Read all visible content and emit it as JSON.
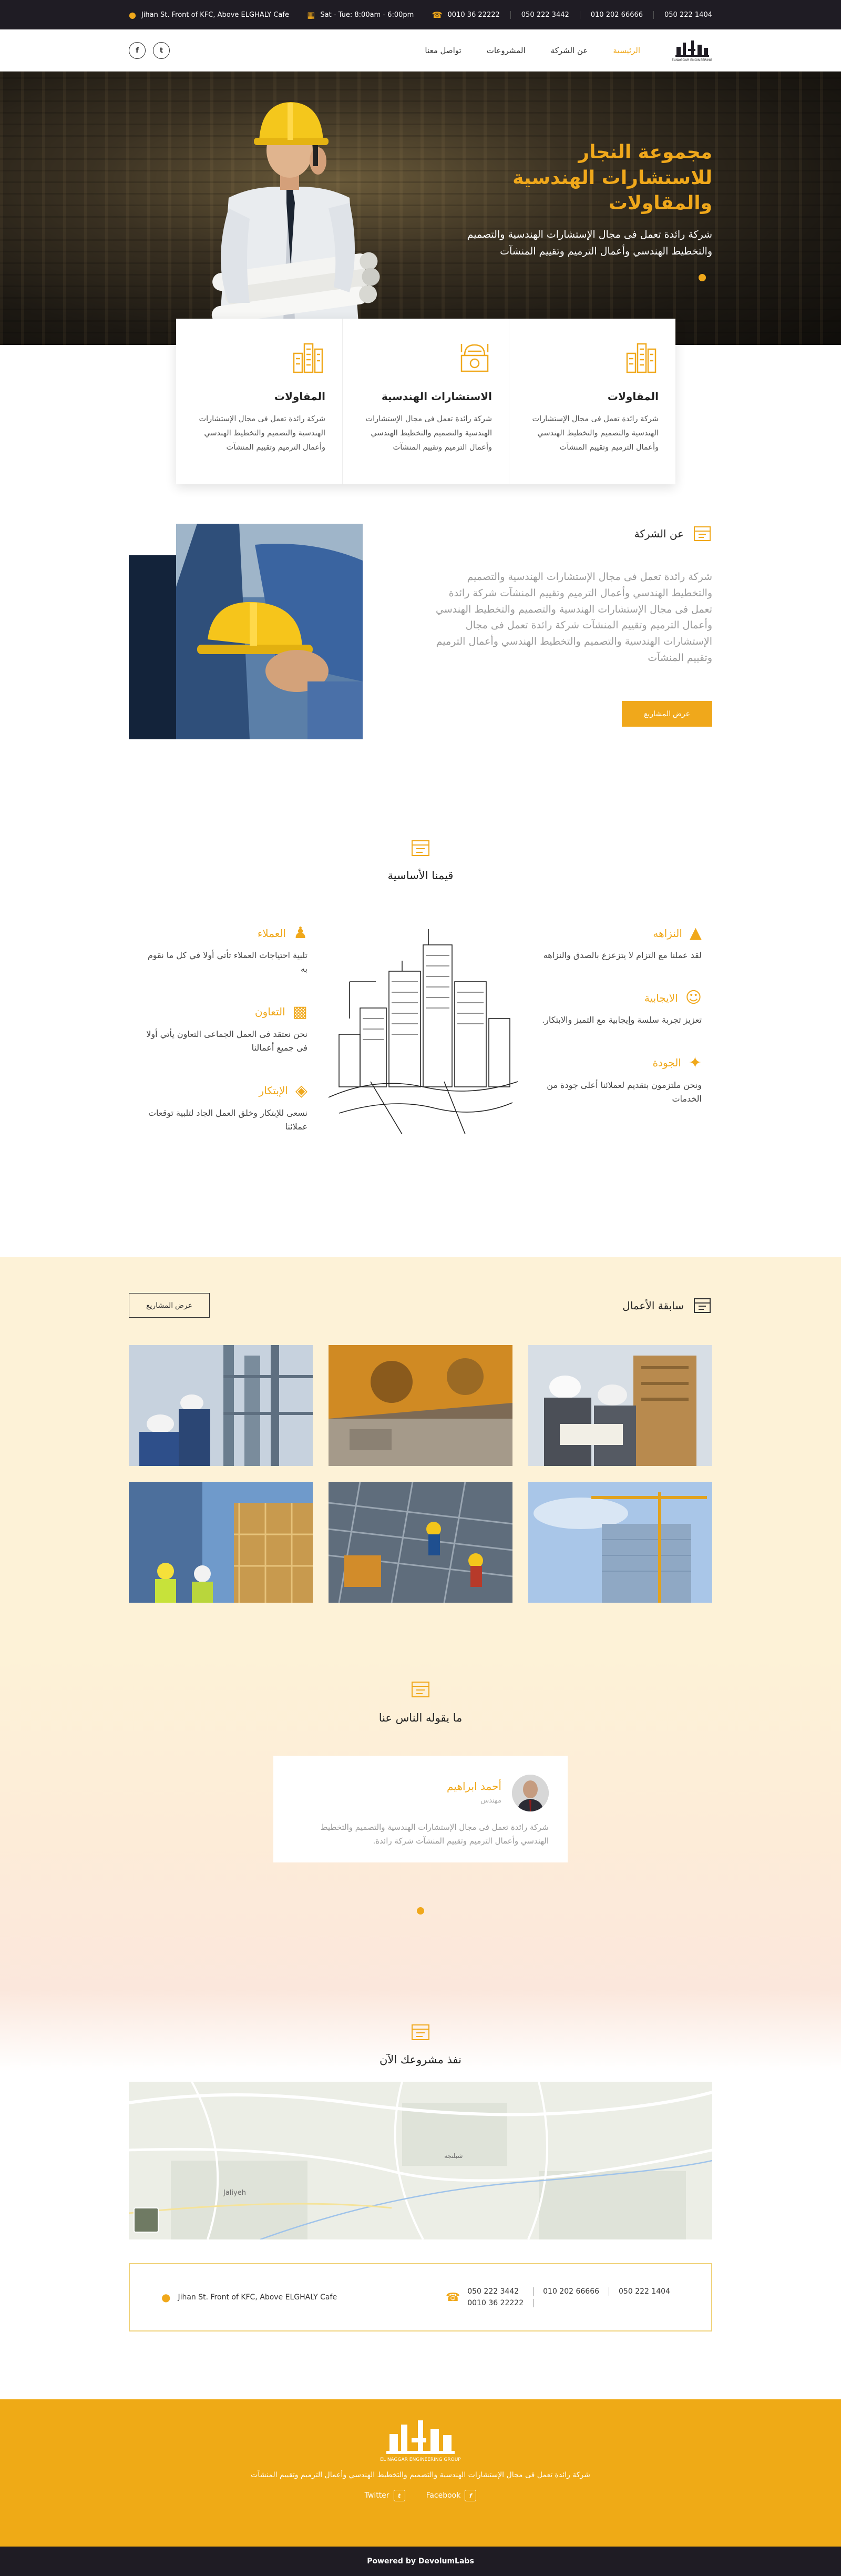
{
  "topbar": {
    "address": "Jihan St. Front of KFC, Above ELGHALY Cafe",
    "hours": "Sat - Tue: 8:00am - 6:00pm",
    "phones": [
      "0010 36 22222",
      "050 222 3442",
      "010 202 66666",
      "050 222 1404"
    ]
  },
  "nav": {
    "items": [
      "الرئيسية",
      "عن الشركة",
      "المشروعات",
      "تواصل معنا"
    ],
    "logo_caption": "ELNAGGAR ENGINEERING",
    "social": {
      "facebook": "f",
      "twitter": "t"
    }
  },
  "hero": {
    "title": "مجموعة النجار للاستشارات الهندسية والمقاولات",
    "text": "شركة رائدة تعمل فى مجال الإستشارات الهندسية والتصميم والتخطيط الهندسي وأعمال الترميم وتقييم المنشآت"
  },
  "features": [
    {
      "title": "المقاولات",
      "text": "شركة رائدة تعمل فى مجال الإستشارات الهندسية والتصميم والتخطيط الهندسي وأعمال الترميم وتقييم المنشآت",
      "icon": "buildings-icon"
    },
    {
      "title": "الاستشارات الهندسية",
      "text": "شركة رائدة تعمل فى مجال الإستشارات الهندسية والتصميم والتخطيط الهندسي وأعمال الترميم وتقييم المنشآت",
      "icon": "engineering-icon"
    },
    {
      "title": "المقاولات",
      "text": "شركة رائدة تعمل فى مجال الإستشارات الهندسية والتصميم والتخطيط الهندسي وأعمال الترميم وتقييم المنشآت",
      "icon": "buildings-icon"
    }
  ],
  "about": {
    "heading": "عن الشركة",
    "text": "شركة رائدة تعمل فى مجال الإستشارات الهندسية والتصميم والتخطيط الهندسي وأعمال الترميم وتقييم المنشآت شركة رائدة تعمل فى مجال الإستشارات الهندسية والتصميم والتخطيط الهندسي وأعمال الترميم وتقييم المنشآت شركة رائدة تعمل فى مجال الإستشارات الهندسية والتصميم والتخطيط الهندسي وأعمال الترميم وتقييم المنشآت",
    "button": "عرض المشاريع"
  },
  "values": {
    "heading": "قيمنا الأساسية",
    "right": [
      {
        "title": "النزاهه",
        "text": "لقد عملنا مع التزام لا يتزعزع بالصدق والنزاهه",
        "icon": "thumbs-up-icon"
      },
      {
        "title": "الايجابية",
        "text": "تعزيز تجربة سلسة وإيجابية مع التميز والابتكار.",
        "icon": "smile-icon"
      },
      {
        "title": "الجودة",
        "text": "ونحن ملتزمون بتقديم لعملائنا أعلى جودة من الخدمات",
        "icon": "quality-hand-icon"
      }
    ],
    "left": [
      {
        "title": "العملاء",
        "text": "تلبية احتياجات العملاء تأتي أولا في كل ما نقوم به",
        "icon": "people-icon"
      },
      {
        "title": "التعاون",
        "text": "نحن نعتقد فى العمل الجماعى التعاون يأتي أولا فى جميع أعمالنا",
        "icon": "handshake-icon"
      },
      {
        "title": "الإبتكار",
        "text": "نسعى للإبتكار وخلق العمل الجاد لتلبية توقعات عملائنا",
        "icon": "innovation-icon"
      }
    ]
  },
  "portfolio": {
    "heading": "سابقة الأعمال",
    "button": "عرض المشاريع",
    "tiles": [
      "engineers-with-plans",
      "heavy-machinery",
      "refinery-workers",
      "crane-sky",
      "site-workers-rebar",
      "workers-scaffold"
    ]
  },
  "testimonials": {
    "heading": "ما يقوله الناس عنا",
    "name": "أحمد ابراهيم",
    "role": "مهندس",
    "text": "شركة رائدة تعمل فى مجال الإستشارات الهندسية والتصميم والتخطيط الهندسي وأعمال الترميم وتقييم المنشآت شركة رائدة."
  },
  "contact": {
    "heading": "نفذ مشروعك الآن",
    "map_labels": [
      "Jaliyeh",
      "شبلنجه"
    ],
    "address": "Jihan St. Front of KFC, Above ELGHALY Cafe",
    "phones": [
      "050 222 1404",
      "010 202 66666",
      "050 222 3442",
      "0010 36 22222"
    ]
  },
  "footer": {
    "logo_caption": "EL NAGGAR ENGINEERING GROUP",
    "text": "شركة رائدة تعمل فى مجال الإستشارات الهندسية والتصميم والتخطيط الهندسي وأعمال الترميم وتقييم المنشآت",
    "facebook": "Facebook",
    "twitter": "Twitter",
    "powered": "Powered by DevolumLabs"
  },
  "colors": {
    "accent": "#f0a81b",
    "dark": "#1f1c24",
    "cream": "#fdf2d7"
  }
}
